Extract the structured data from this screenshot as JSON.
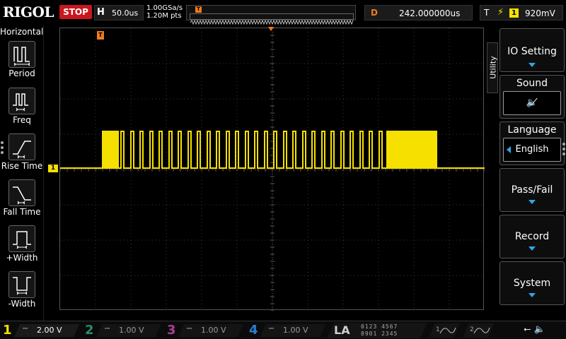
{
  "brand": "RIGOL",
  "run_state": "STOP",
  "colors": {
    "ch1": "#f5e000",
    "ch2": "#2a8c6e",
    "ch3": "#b03a9a",
    "ch4": "#2a7fd0",
    "trigger": "#f07a1e",
    "stop": "#c8171e",
    "menu_accent": "#2fa6e8"
  },
  "horizontal": {
    "label": "H",
    "timebase": "50.0us",
    "sample_rate": "1.00GSa/s",
    "memory_depth": "1.20M pts"
  },
  "memory_bar": {
    "trigger_marker": "T"
  },
  "delay": {
    "label": "D",
    "value": "242.000000us"
  },
  "trigger": {
    "label": "T",
    "edge_icon": "rising-edge-icon",
    "source": "1",
    "level": "920mV"
  },
  "left_panel": {
    "title": "Horizontal",
    "items": [
      {
        "label": "Period",
        "icon": "period-icon"
      },
      {
        "label": "Freq",
        "icon": "frequency-icon"
      },
      {
        "label": "Rise Time",
        "icon": "rise-time-icon"
      },
      {
        "label": "Fall Time",
        "icon": "fall-time-icon"
      },
      {
        "label": "+Width",
        "icon": "positive-width-icon"
      },
      {
        "label": "-Width",
        "icon": "negative-width-icon"
      }
    ]
  },
  "waveform": {
    "ch1_marker": "1",
    "trigger_level_marker": "T",
    "trigger_position_marker": "T"
  },
  "right_menu": {
    "tab": "Utility",
    "io_setting": "IO Setting",
    "sound": {
      "label": "Sound",
      "icon": "speaker-muted-icon"
    },
    "language": {
      "label": "Language",
      "value": "English"
    },
    "pass_fail": "Pass/Fail",
    "record": "Record",
    "system": "System"
  },
  "channels": [
    {
      "number": "1",
      "coupling": "⎓",
      "scale": "2.00 V"
    },
    {
      "number": "2",
      "coupling": "⎓",
      "scale": "1.00 V"
    },
    {
      "number": "3",
      "coupling": "⎓",
      "scale": "1.00 V"
    },
    {
      "number": "4",
      "coupling": "⎓",
      "scale": "1.00 V"
    }
  ],
  "la": {
    "label": "LA",
    "row1": "0123 4567",
    "row2": "8901 2345"
  },
  "generators": [
    {
      "number": "1"
    },
    {
      "number": "2"
    }
  ],
  "status_icons": [
    "usb-icon",
    "speaker-muted-icon"
  ]
}
